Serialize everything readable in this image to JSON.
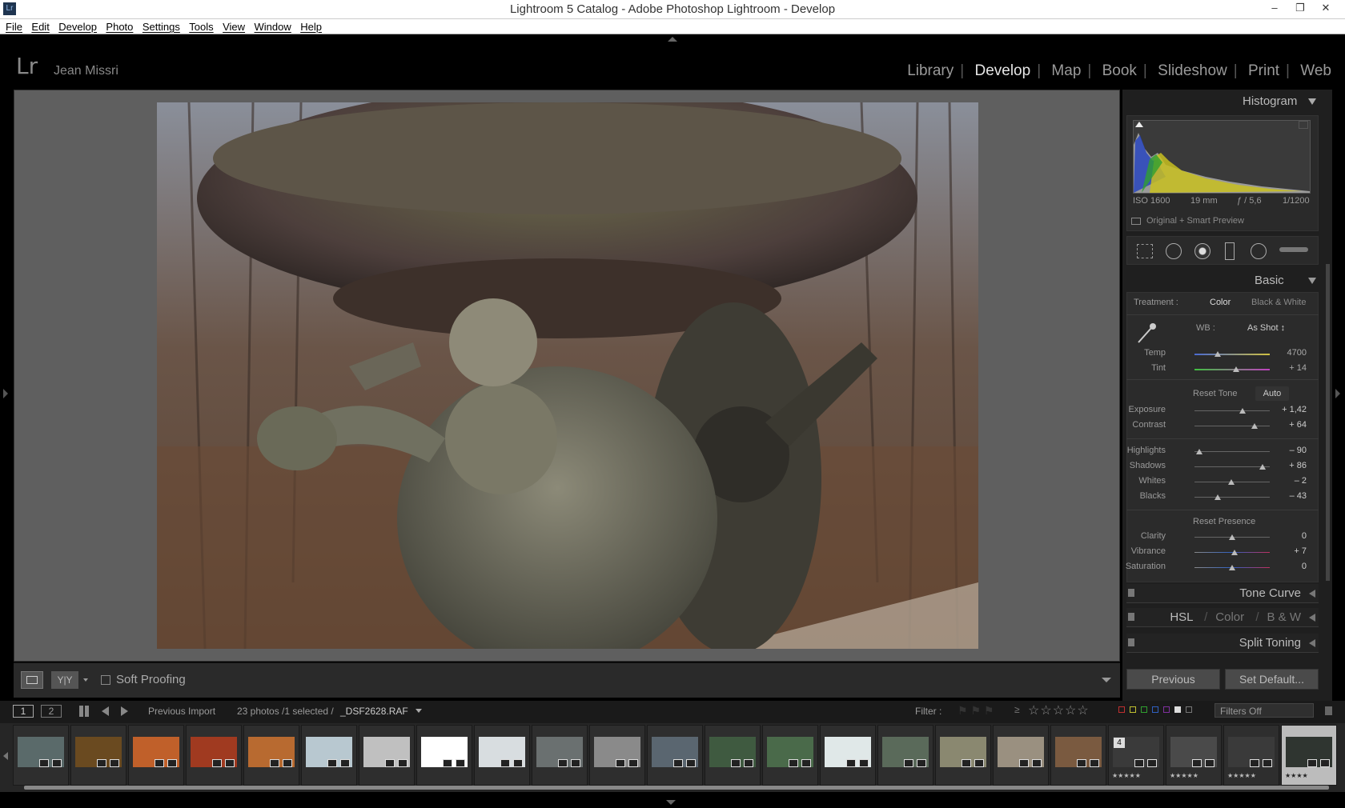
{
  "window": {
    "title": "Lightroom 5 Catalog - Adobe Photoshop Lightroom - Develop",
    "app_icon": "Lr"
  },
  "menu": [
    "File",
    "Edit",
    "Develop",
    "Photo",
    "Settings",
    "Tools",
    "View",
    "Window",
    "Help"
  ],
  "identity": {
    "brand": "Lr",
    "user": "Jean Missri"
  },
  "modules": [
    "Library",
    "Develop",
    "Map",
    "Book",
    "Slideshow",
    "Print",
    "Web"
  ],
  "active_module": "Develop",
  "histogram": {
    "title": "Histogram",
    "iso": "ISO 1600",
    "focal": "19 mm",
    "aperture": "ƒ / 5,6",
    "shutter": "1/1200",
    "preview": "Original + Smart Preview"
  },
  "basic": {
    "title": "Basic",
    "treatment_label": "Treatment :",
    "color": "Color",
    "bw": "Black & White",
    "wb_label": "WB :",
    "wb_value": "As Shot ↕",
    "temp_label": "Temp",
    "temp": "4700",
    "temp_pos": 0.31,
    "tint_label": "Tint",
    "tint": "+ 14",
    "tint_pos": 0.55,
    "reset_tone": "Reset Tone",
    "auto": "Auto",
    "tone": [
      {
        "label": "Exposure",
        "value": "+ 1,42",
        "pos": 0.64
      },
      {
        "label": "Contrast",
        "value": "+ 64",
        "pos": 0.8
      }
    ],
    "tone2": [
      {
        "label": "Highlights",
        "value": "– 90",
        "pos": 0.06
      },
      {
        "label": "Shadows",
        "value": "+ 86",
        "pos": 0.9
      },
      {
        "label": "Whites",
        "value": "– 2",
        "pos": 0.49
      },
      {
        "label": "Blacks",
        "value": "– 43",
        "pos": 0.31
      }
    ],
    "reset_presence": "Reset Presence",
    "presence": [
      {
        "label": "Clarity",
        "value": "0",
        "pos": 0.5
      },
      {
        "label": "Vibrance",
        "value": "+ 7",
        "pos": 0.53
      },
      {
        "label": "Saturation",
        "value": "0",
        "pos": 0.5
      }
    ]
  },
  "panels": {
    "tone_curve": "Tone Curve",
    "hsl": "HSL",
    "color": "Color",
    "bw": "B & W",
    "slash": "/",
    "split": "Split Toning"
  },
  "buttons": {
    "previous": "Previous",
    "set_default": "Set Default..."
  },
  "toolbar": {
    "soft_proofing": "Soft Proofing",
    "yy": "Y|Y"
  },
  "filmheader": {
    "screen1": "1",
    "screen2": "2",
    "source": "Previous Import",
    "count": "23 photos /1 selected /",
    "file": "_DSF2628.RAF",
    "filter_label": "Filter :",
    "filters_off": "Filters Off"
  },
  "film": {
    "thumbs": [
      "#5a6a6a",
      "#6a4a20",
      "#c0602a",
      "#a03a20",
      "#b86a30",
      "#b8c8d0",
      "#c0c0c0",
      "#ffffff",
      "#d8dde0",
      "#6a7070",
      "#8a8a8a",
      "#5a6670",
      "#3f5a40",
      "#4a6a4a",
      "#e0e8e8",
      "#5a6a5a",
      "#8a8870",
      "#9a9080",
      "#7a5a40",
      "#3a3a3a",
      "#4a4a4a",
      "#3a3a3a",
      "#2f3530"
    ],
    "stack_count": "4",
    "stars": "★★★★★",
    "stars_sel": "★★★★"
  }
}
